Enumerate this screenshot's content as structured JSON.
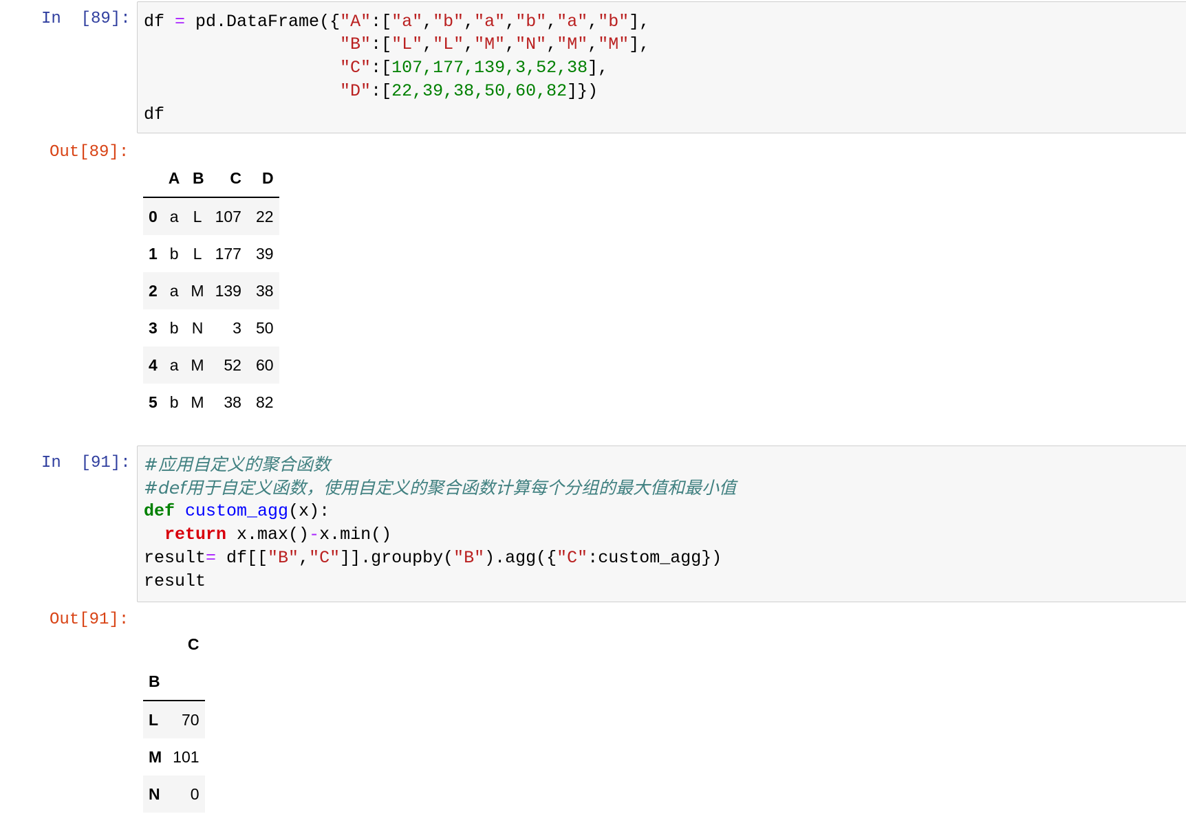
{
  "cell1": {
    "in_prompt": "In  [89]:",
    "out_prompt": "Out[89]:",
    "code": {
      "l1": {
        "a": "df ",
        "op": "=",
        "b": " pd.DataFrame({",
        "s1": "\"A\"",
        "c1": ":[",
        "s2": "\"a\"",
        "c2": ",",
        "s3": "\"b\"",
        "c3": ",",
        "s4": "\"a\"",
        "c4": ",",
        "s5": "\"b\"",
        "c5": ",",
        "s6": "\"a\"",
        "c6": ",",
        "s7": "\"b\"",
        "c7": "],"
      },
      "l2": {
        "pad": "                   ",
        "s1": "\"B\"",
        "c1": ":[",
        "s2": "\"L\"",
        "c2": ",",
        "s3": "\"L\"",
        "c3": ",",
        "s4": "\"M\"",
        "c4": ",",
        "s5": "\"N\"",
        "c5": ",",
        "s6": "\"M\"",
        "c6": ",",
        "s7": "\"M\"",
        "c7": "],"
      },
      "l3": {
        "pad": "                   ",
        "s1": "\"C\"",
        "c1": ":[",
        "nums": "107,177,139,3,52,38",
        "c2": "],"
      },
      "l4": {
        "pad": "                   ",
        "s1": "\"D\"",
        "c1": ":[",
        "nums": "22,39,38,50,60,82",
        "c2": "]})"
      },
      "l5": "df"
    },
    "table": {
      "columns": [
        "A",
        "B",
        "C",
        "D"
      ],
      "rows": [
        {
          "idx": "0",
          "A": "a",
          "B": "L",
          "C": "107",
          "D": "22"
        },
        {
          "idx": "1",
          "A": "b",
          "B": "L",
          "C": "177",
          "D": "39"
        },
        {
          "idx": "2",
          "A": "a",
          "B": "M",
          "C": "139",
          "D": "38"
        },
        {
          "idx": "3",
          "A": "b",
          "B": "N",
          "C": "3",
          "D": "50"
        },
        {
          "idx": "4",
          "A": "a",
          "B": "M",
          "C": "52",
          "D": "60"
        },
        {
          "idx": "5",
          "A": "b",
          "B": "M",
          "C": "38",
          "D": "82"
        }
      ]
    }
  },
  "cell2": {
    "in_prompt": "In  [91]:",
    "out_prompt": "Out[91]:",
    "code": {
      "l1": "#应用自定义的聚合函数",
      "l2": "#def用于自定义函数，使用自定义的聚合函数计算每个分组的最大值和最小值",
      "l3": {
        "kw": "def",
        "sp": " ",
        "fn": "custom_agg",
        "rest": "(x):"
      },
      "l4": {
        "pad": "  ",
        "kw": "return",
        "rest1": " x.max()",
        "op": "-",
        "rest2": "x.min()"
      },
      "l5": {
        "a": "result",
        "op": "=",
        "b": " df[[",
        "s1": "\"B\"",
        "c1": ",",
        "s2": "\"C\"",
        "c2": "]].groupby(",
        "s3": "\"B\"",
        "c3": ").agg({",
        "s4": "\"C\"",
        "c4": ":custom_agg})"
      },
      "l6": "result"
    },
    "table": {
      "column": "C",
      "index_name": "B",
      "rows": [
        {
          "idx": "L",
          "C": "70"
        },
        {
          "idx": "M",
          "C": "101"
        },
        {
          "idx": "N",
          "C": "0"
        }
      ]
    }
  },
  "colors": {
    "in_prompt": "#303f9f",
    "out_prompt": "#d84315",
    "string": "#ba2121",
    "number": "#008000",
    "keyword": "#008000",
    "comment": "#408080"
  }
}
